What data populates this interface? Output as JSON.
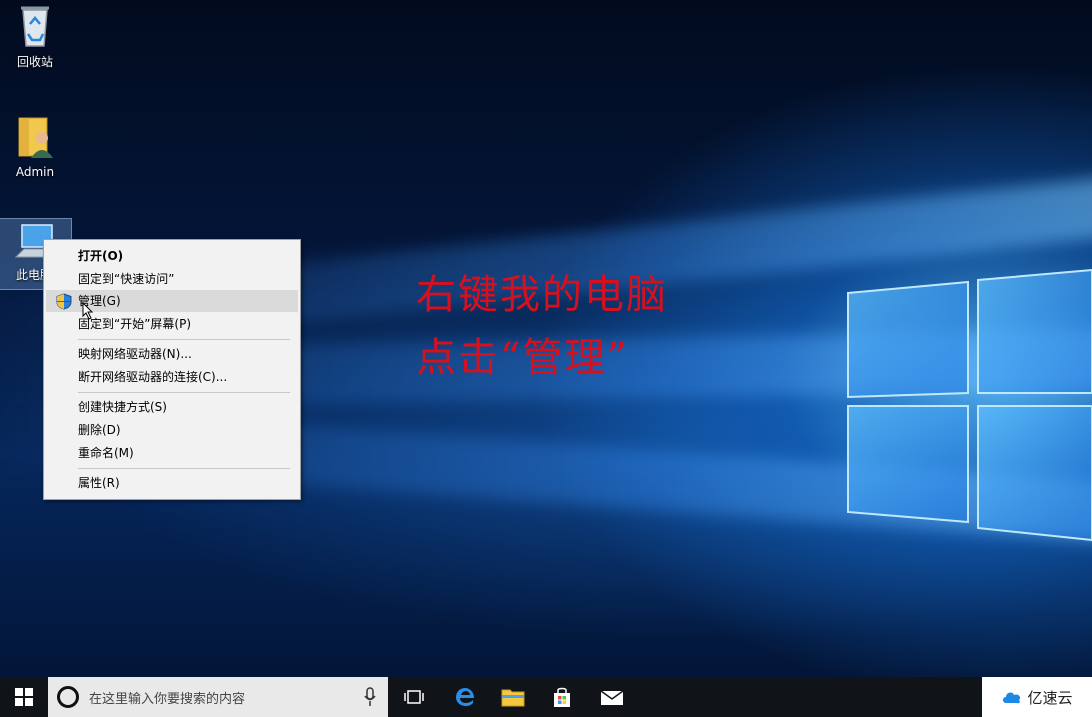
{
  "desktop": {
    "icons": [
      {
        "label": "回收站",
        "icon": "recycle-bin-icon"
      },
      {
        "label": "Admin",
        "icon": "user-folder-icon"
      },
      {
        "label": "此电脑",
        "icon": "computer-icon"
      }
    ]
  },
  "context_menu": {
    "items": [
      {
        "label": "打开(O)",
        "bold": true
      },
      {
        "label": "固定到“快速访问”"
      },
      {
        "label": "管理(G)",
        "icon": "uac-shield-icon",
        "highlighted": true
      },
      {
        "label": "固定到“开始”屏幕(P)"
      },
      {
        "label": "映射网络驱动器(N)..."
      },
      {
        "label": "断开网络驱动器的连接(C)..."
      },
      {
        "label": "创建快捷方式(S)"
      },
      {
        "label": "删除(D)"
      },
      {
        "label": "重命名(M)"
      },
      {
        "label": "属性(R)"
      }
    ]
  },
  "annotation": {
    "line1": "右键我的电脑",
    "line2": "点击“管理”",
    "color": "#d8101e"
  },
  "taskbar": {
    "start_icon": "windows-logo-icon",
    "search_placeholder": "在这里输入你要搜索的内容",
    "pinned": [
      "task-view-icon",
      "edge-icon",
      "file-explorer-icon",
      "store-icon",
      "mail-icon"
    ]
  },
  "watermark": {
    "text": "亿速云"
  }
}
